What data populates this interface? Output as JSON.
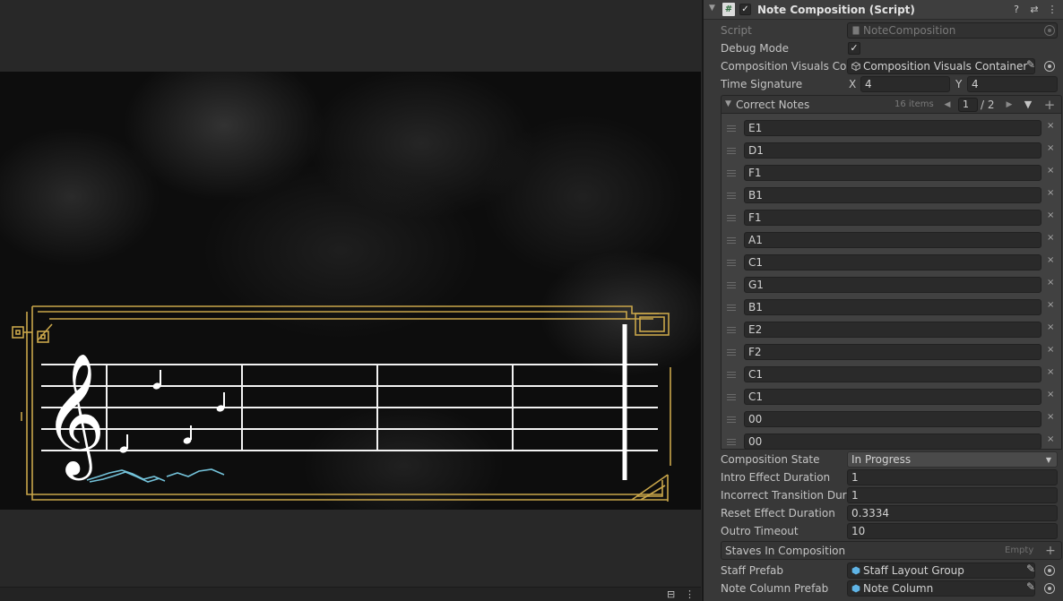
{
  "game_view": {
    "status_icons": [
      "lock-icon",
      "kebab-menu-icon"
    ]
  },
  "inspector": {
    "component": {
      "title": "Note Composition (Script)",
      "enabled_check": "✓",
      "header_icons": [
        "script-icon",
        "help-icon",
        "presets-icon",
        "kebab-menu-icon"
      ]
    },
    "fields": {
      "script": {
        "label": "Script",
        "value": "NoteComposition"
      },
      "debug_mode": {
        "label": "Debug Mode",
        "checked": true,
        "check": "✓"
      },
      "composition_visuals_container": {
        "label": "Composition Visuals Container",
        "value": "Composition Visuals Container"
      },
      "time_signature": {
        "label": "Time Signature",
        "x_label": "X",
        "x_value": "4",
        "y_label": "Y",
        "y_value": "4"
      },
      "composition_state": {
        "label": "Composition State",
        "value": "In Progress"
      },
      "intro_effect_duration": {
        "label": "Intro Effect Duration",
        "value": "1"
      },
      "incorrect_transition_duration": {
        "label": "Incorrect Transition Duration",
        "value": "1"
      },
      "reset_effect_duration": {
        "label": "Reset Effect Duration",
        "value": "0.3334"
      },
      "outro_timeout": {
        "label": "Outro Timeout",
        "value": "10"
      },
      "staff_prefab": {
        "label": "Staff Prefab",
        "value": "Staff Layout Group"
      },
      "note_column_prefab": {
        "label": "Note Column Prefab",
        "value": "Note Column"
      }
    },
    "correct_notes": {
      "title": "Correct Notes",
      "count": "16 items",
      "page_current": "1",
      "page_total": "/ 2",
      "items": [
        "E1",
        "D1",
        "F1",
        "B1",
        "F1",
        "A1",
        "C1",
        "G1",
        "B1",
        "E2",
        "F2",
        "C1",
        "C1",
        "00",
        "00"
      ],
      "remove_glyph": "×"
    },
    "staves_in_composition": {
      "title": "Staves In Composition",
      "empty_label": "Empty"
    }
  }
}
